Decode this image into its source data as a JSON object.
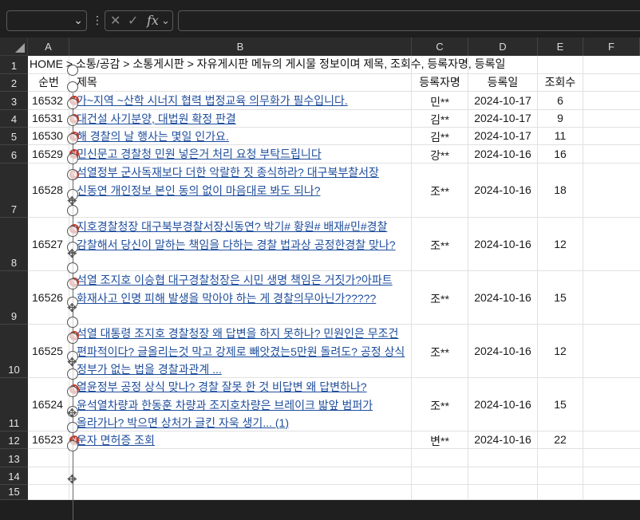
{
  "formula_bar": {
    "name_box_value": "",
    "cancel_icon": "✕",
    "enter_icon": "✓",
    "fx_label": "fx",
    "formula_value": ""
  },
  "columns": [
    "A",
    "B",
    "C",
    "D",
    "E",
    "F"
  ],
  "rows": [
    "1",
    "2",
    "3",
    "4",
    "5",
    "6",
    "7",
    "8",
    "9",
    "10",
    "11",
    "12",
    "13",
    "14",
    "15"
  ],
  "header_line": "HOME > 소통/공감 > 소통게시판 > 자유게시판 메뉴의 게시물 정보이며 제목, 조회수, 등록자명, 등록일",
  "table_headers": {
    "no": "순번",
    "title": "제목",
    "author": "등록자명",
    "date": "등록일",
    "views": "조회수"
  },
  "records": [
    {
      "no": "16532",
      "title": "가~지역 ~산학 시너지 협력 법정교육 의무화가 필수입니다.",
      "author": "민**",
      "date": "2024-10-17",
      "views": "6"
    },
    {
      "no": "16531",
      "title": "대건설 사기분양, 대법원 확정 판결",
      "author": "김**",
      "date": "2024-10-17",
      "views": "9"
    },
    {
      "no": "16530",
      "title": "해 경찰의 날 행사는 몇일 인가요.",
      "author": "김**",
      "date": "2024-10-17",
      "views": "11"
    },
    {
      "no": "16529",
      "title": "민신문고 경찰청 민원 넣은거 처리 요청 부탁드립니다",
      "author": "강**",
      "date": "2024-10-16",
      "views": "16"
    },
    {
      "no": "16528",
      "title": "석열정부 군사독재보다 더한 악랄한 짓 종식하라? 대구북부찰서장 신동연 개인정보 본인 동의 없이 마음대로 봐도 되나?",
      "author": "조**",
      "date": "2024-10-16",
      "views": "18"
    },
    {
      "no": "16527",
      "title": "지호경찰청장 대구북부경찰서장신동연? 박기# 황원# 배재#민#경찰 감찰해서 당신이 말하는 책임을 다하는 경찰 법과상 공정한경찰 맞나?",
      "author": "조**",
      "date": "2024-10-16",
      "views": "12"
    },
    {
      "no": "16526",
      "title": "석열 조지호 이승협 대구경찰청장은 시민 생명 책임은 거짓가?아파트 화재사고 인명 피해 발생을 막아야 하는 게 경찰의무아닌가?????",
      "author": "조**",
      "date": "2024-10-16",
      "views": "15"
    },
    {
      "no": "16525",
      "title": "석열 대통령 조지호 경찰청장 왜 답변을 하지 못하나? 민원인은 무조건 편파적이다? 글올리는것 막고 강제로 빼앗겼는5만원 돌려도? 공정 상식 정부가 없는 법을 경찰과관계 ...",
      "author": "조**",
      "date": "2024-10-16",
      "views": "12"
    },
    {
      "no": "16524",
      "title": "열윤정부 공정 상식 맞나? 경찰 잘못 한 것 비답변 왜 답변하나?윤석열차량과 한동훈 차량과 조지호차량은 브레이크 밟앞 범퍼가 올라가나? 박으면 상처가 글킨 자욱 생기... (1)",
      "author": "조**",
      "date": "2024-10-16",
      "views": "15"
    },
    {
      "no": "16523",
      "title": "운자 면허증 조회",
      "author": "변**",
      "date": "2024-10-16",
      "views": "22"
    }
  ],
  "badge_label": "N",
  "icons": {
    "dropdown": "chevron-down-icon",
    "cancel": "close-icon",
    "enter": "check-icon",
    "function": "fx-icon",
    "move": "move-handle-icon"
  }
}
